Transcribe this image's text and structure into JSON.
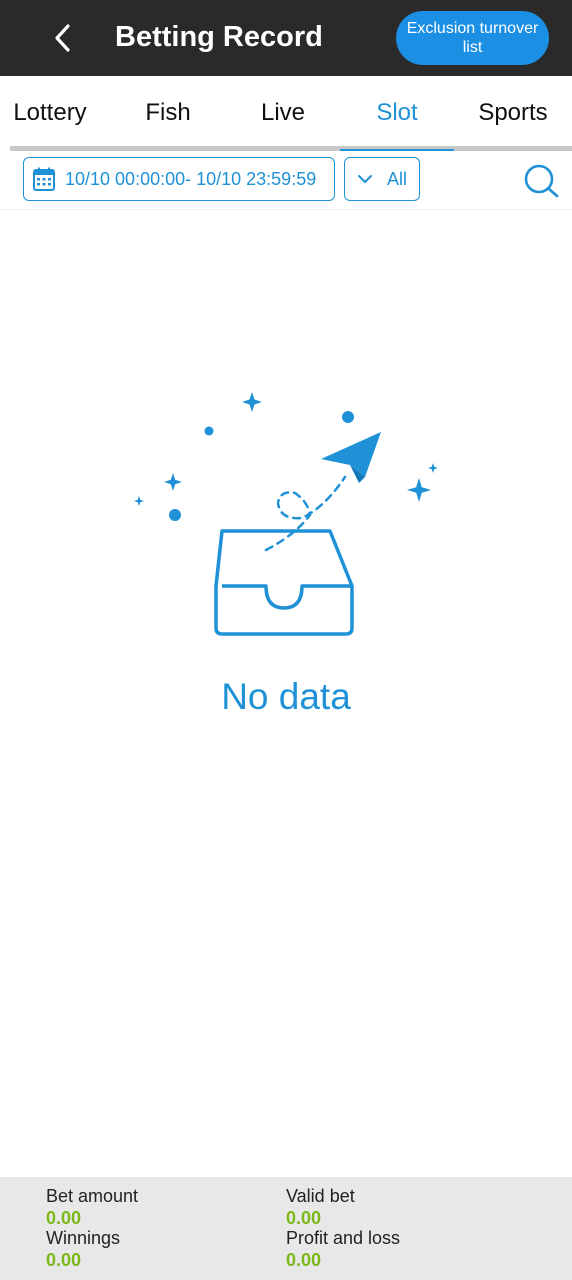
{
  "header": {
    "title": "Betting Record",
    "exclusion_button": "Exclusion turnover list"
  },
  "tabs": [
    {
      "label": "Lottery"
    },
    {
      "label": "Fish"
    },
    {
      "label": "Live"
    },
    {
      "label": "Slot",
      "active": true
    },
    {
      "label": "Sports"
    }
  ],
  "filter": {
    "date_range": "10/10 00:00:00- 10/10 23:59:59",
    "type_select": "All"
  },
  "empty_state": {
    "message": "No data"
  },
  "summary": {
    "bet_amount_label": "Bet amount",
    "bet_amount_value": "0.00",
    "valid_bet_label": "Valid bet",
    "valid_bet_value": "0.00",
    "winnings_label": "Winnings",
    "winnings_value": "0.00",
    "profit_loss_label": "Profit and loss",
    "profit_loss_value": "0.00"
  },
  "colors": {
    "accent": "#1f91d6",
    "header_bg": "#2a2a2a",
    "button_bg": "#1a8fe3",
    "value_green": "#7bb81a",
    "summary_bg": "#e8e8e8"
  }
}
